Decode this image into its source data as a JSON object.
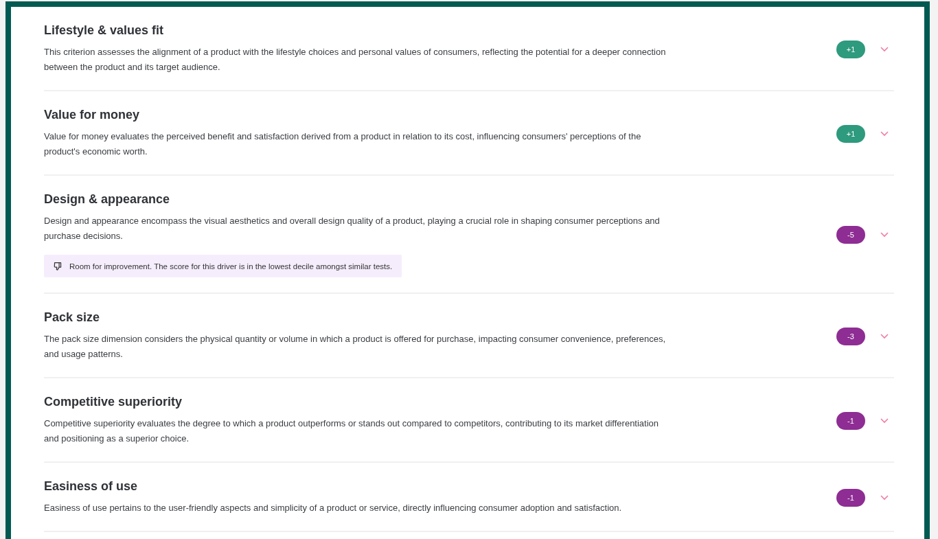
{
  "drivers": [
    {
      "title": "Lifestyle & values fit",
      "description": "This criterion assesses the alignment of a product with the lifestyle choices and personal values of consumers, reflecting the potential for a deeper connection between the product and its target audience.",
      "score": "+1",
      "color": "#2e9a7e"
    },
    {
      "title": "Value for money",
      "description": "Value for money evaluates the perceived benefit and satisfaction derived from a product in relation to its cost, influencing consumers' perceptions of the product's economic worth.",
      "score": "+1",
      "color": "#2e9a7e"
    },
    {
      "title": "Design & appearance",
      "description": "Design and appearance encompass the visual aesthetics and overall design quality of a product, playing a crucial role in shaping consumer perceptions and purchase decisions.",
      "score": "-5",
      "color": "#8e2d93",
      "note": "Room for improvement. The score for this driver is in the lowest decile amongst similar tests."
    },
    {
      "title": "Pack size",
      "description": "The pack size dimension considers the physical quantity or volume in which a product is offered for purchase, impacting consumer convenience, preferences, and usage patterns.",
      "score": "-3",
      "color": "#8e2d93"
    },
    {
      "title": "Competitive superiority",
      "description": "Competitive superiority evaluates the degree to which a product outperforms or stands out compared to competitors, contributing to its market differentiation and positioning as a superior choice.",
      "score": "-1",
      "color": "#8e2d93"
    },
    {
      "title": "Easiness of use",
      "description": "Easiness of use pertains to the user-friendly aspects and simplicity of a product or service, directly influencing consumer adoption and satisfaction.",
      "score": "-1",
      "color": "#8e2d93"
    }
  ]
}
